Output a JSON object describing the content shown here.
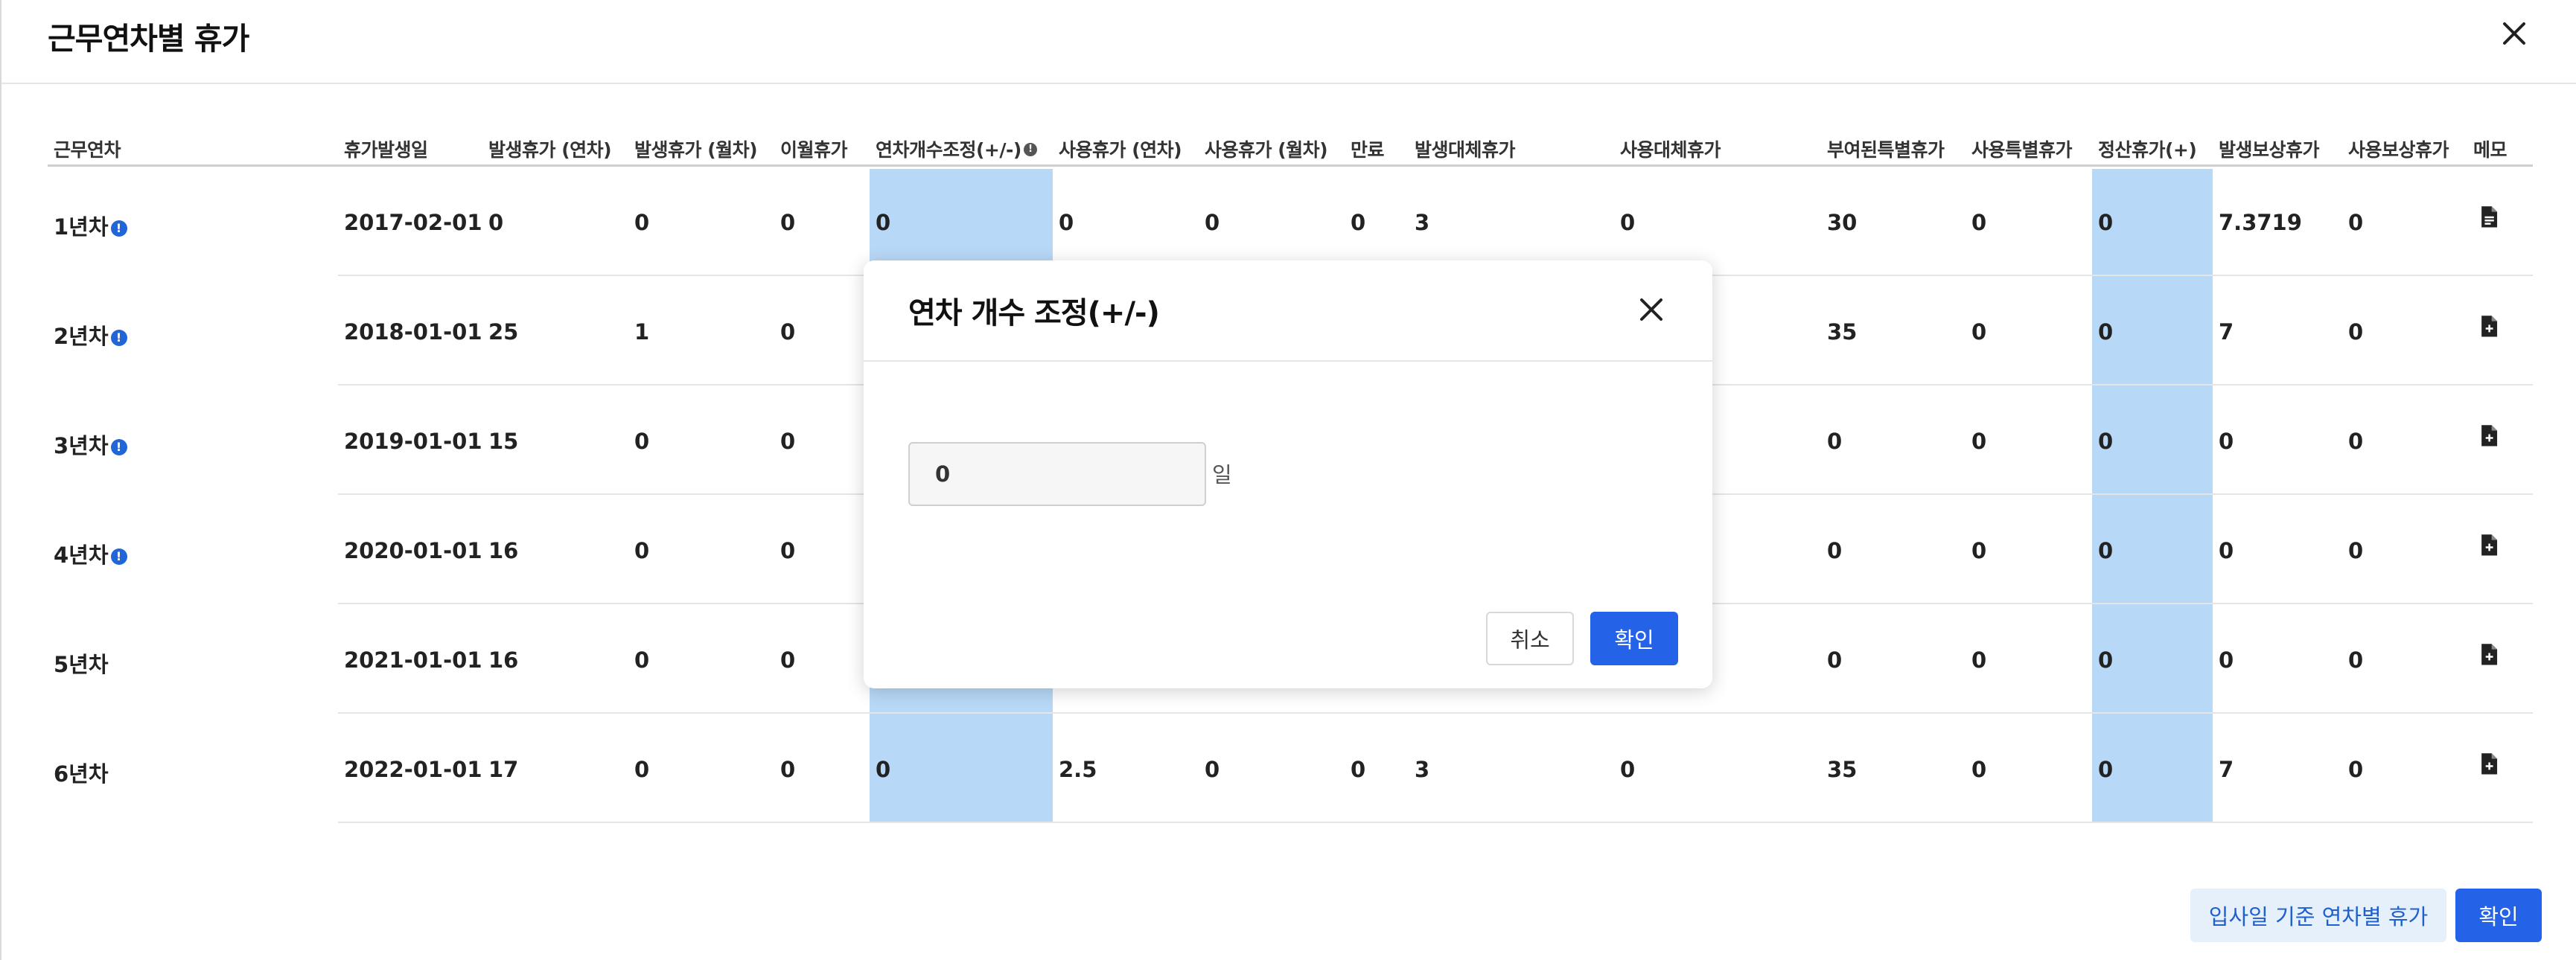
{
  "dialog": {
    "title": "근무연차별 휴가",
    "close_icon": "close-icon"
  },
  "table": {
    "headers": [
      "근무연차",
      "휴가발생일",
      "발생휴가 (연차)",
      "발생휴가 (월차)",
      "이월휴가",
      "연차개수조정(+/-)",
      "사용휴가 (연차)",
      "사용휴가 (월차)",
      "만료",
      "발생대체휴가",
      "사용대체휴가",
      "부여된특별휴가",
      "사용특별휴가",
      "정산휴가(+)",
      "발생보상휴가",
      "사용보상휴가",
      "메모"
    ],
    "info_glyph": "!",
    "rows": [
      {
        "year": "1년차",
        "has_info": true,
        "cells": [
          "2017-02-01",
          "0",
          "0",
          "0",
          "0",
          "0",
          "0",
          "0",
          "3",
          "0",
          "30",
          "0",
          "0",
          "7.3719",
          "0"
        ],
        "memo_icon": "document-icon"
      },
      {
        "year": "2년차",
        "has_info": true,
        "cells": [
          "2018-01-01",
          "25",
          "1",
          "0",
          "",
          "",
          "",
          "",
          "",
          "",
          "35",
          "0",
          "0",
          "7",
          "0"
        ],
        "memo_icon": "add-document-icon"
      },
      {
        "year": "3년차",
        "has_info": true,
        "cells": [
          "2019-01-01",
          "15",
          "0",
          "0",
          "",
          "",
          "",
          "",
          "",
          "",
          "0",
          "0",
          "0",
          "0",
          "0"
        ],
        "memo_icon": "add-document-icon"
      },
      {
        "year": "4년차",
        "has_info": true,
        "cells": [
          "2020-01-01",
          "16",
          "0",
          "0",
          "",
          "",
          "",
          "",
          "",
          "",
          "0",
          "0",
          "0",
          "0",
          "0"
        ],
        "memo_icon": "add-document-icon"
      },
      {
        "year": "5년차",
        "has_info": false,
        "cells": [
          "2021-01-01",
          "16",
          "0",
          "0",
          "",
          "",
          "",
          "",
          "",
          "",
          "0",
          "0",
          "0",
          "0",
          "0"
        ],
        "memo_icon": "add-document-icon"
      },
      {
        "year": "6년차",
        "has_info": false,
        "cells": [
          "2022-01-01",
          "17",
          "0",
          "0",
          "0",
          "2.5",
          "0",
          "0",
          "3",
          "0",
          "35",
          "0",
          "0",
          "7",
          "0"
        ],
        "memo_icon": "add-document-icon"
      }
    ]
  },
  "footer": {
    "secondary_label": "입사일 기준 연차별 휴가",
    "confirm_label": "확인"
  },
  "modal": {
    "title": "연차 개수 조정(+/-)",
    "input_value": "0",
    "unit": "일",
    "cancel_label": "취소",
    "ok_label": "확인",
    "close_icon": "close-icon"
  },
  "colors": {
    "highlight": "#b8d8f7",
    "primary": "#2463e8",
    "info": "#2066d8"
  }
}
